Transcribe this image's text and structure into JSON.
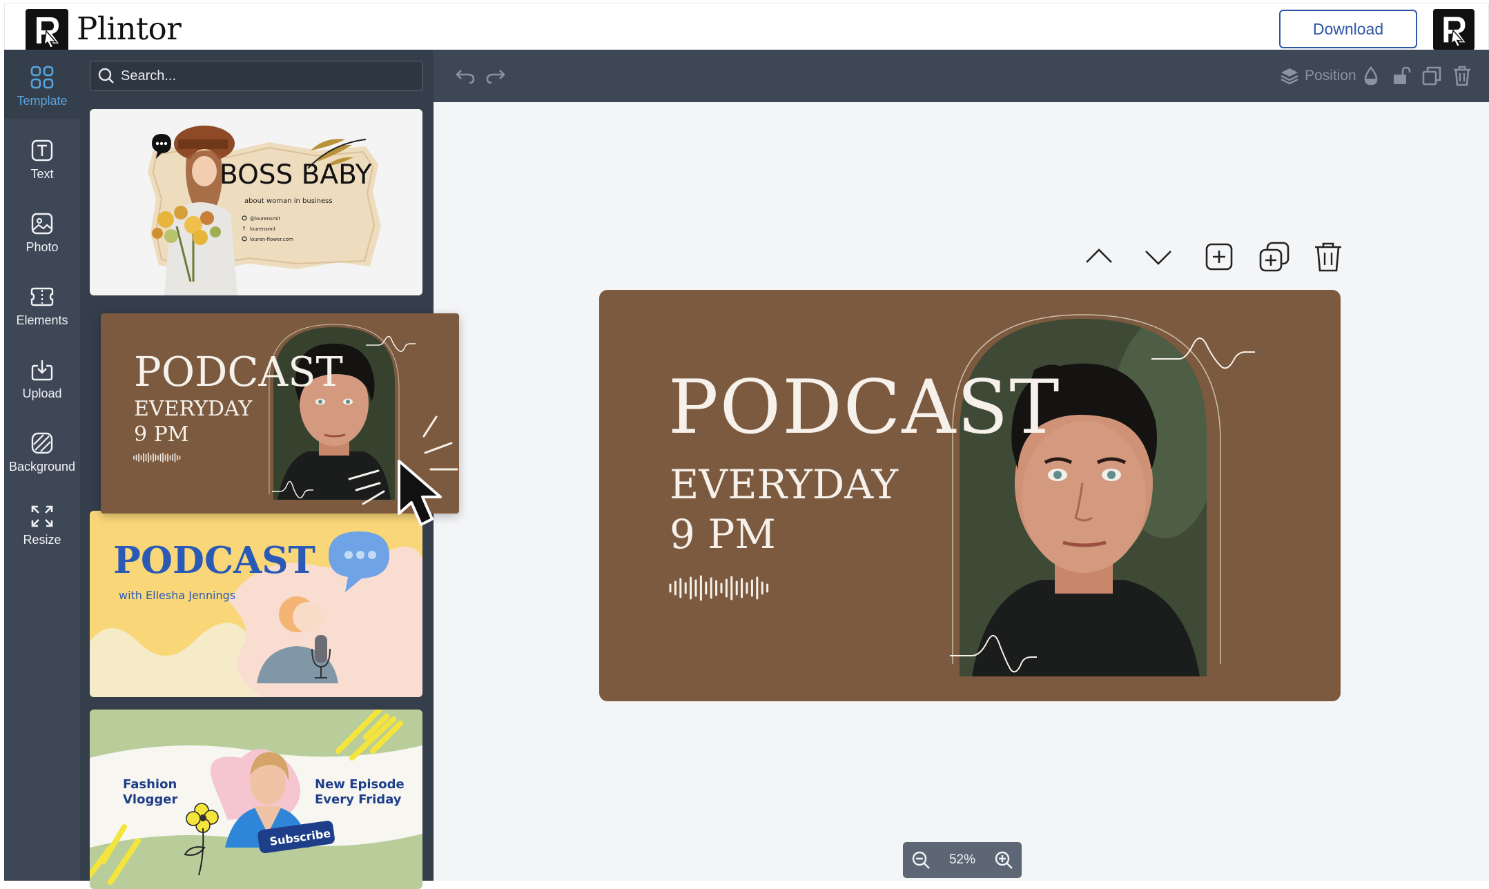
{
  "app": {
    "name": "Plintor",
    "download_label": "Download"
  },
  "nav": {
    "items": [
      {
        "label": "Template",
        "icon": "template-grid-icon",
        "active": true
      },
      {
        "label": "Text",
        "icon": "text-icon"
      },
      {
        "label": "Photo",
        "icon": "photo-icon"
      },
      {
        "label": "Elements",
        "icon": "elements-icon"
      },
      {
        "label": "Upload",
        "icon": "upload-icon"
      },
      {
        "label": "Background",
        "icon": "background-icon"
      },
      {
        "label": "Resize",
        "icon": "resize-icon"
      }
    ]
  },
  "search": {
    "placeholder": "Search..."
  },
  "templates": {
    "boss_baby": {
      "title": "BOSS BABY",
      "subtitle": "about woman in business",
      "contacts": [
        "@lourensmit",
        "lourensmit",
        "louren-flower.com"
      ]
    },
    "podcast_brown": {
      "title": "PODCAST",
      "line1": "EVERYDAY",
      "line2": "9 PM"
    },
    "podcast_yellow": {
      "title": "PODCAST",
      "subtitle": "with Ellesha Jennings"
    },
    "fashion": {
      "left": [
        "Fashion",
        "Vlogger"
      ],
      "right": [
        "New Episode",
        "Every Friday"
      ],
      "button": "Subscribe"
    }
  },
  "toolbar": {
    "position_label": "Position"
  },
  "design": {
    "title": "PODCAST",
    "line1": "EVERYDAY",
    "line2": "9 PM"
  },
  "zoom": {
    "value": "52%"
  },
  "colors": {
    "brown": "#7c5a40",
    "accent_blue": "#2c55a6",
    "active_nav": "#58a6e0",
    "yellow_card": "#f9d779",
    "green_card": "#b9cd9a"
  }
}
